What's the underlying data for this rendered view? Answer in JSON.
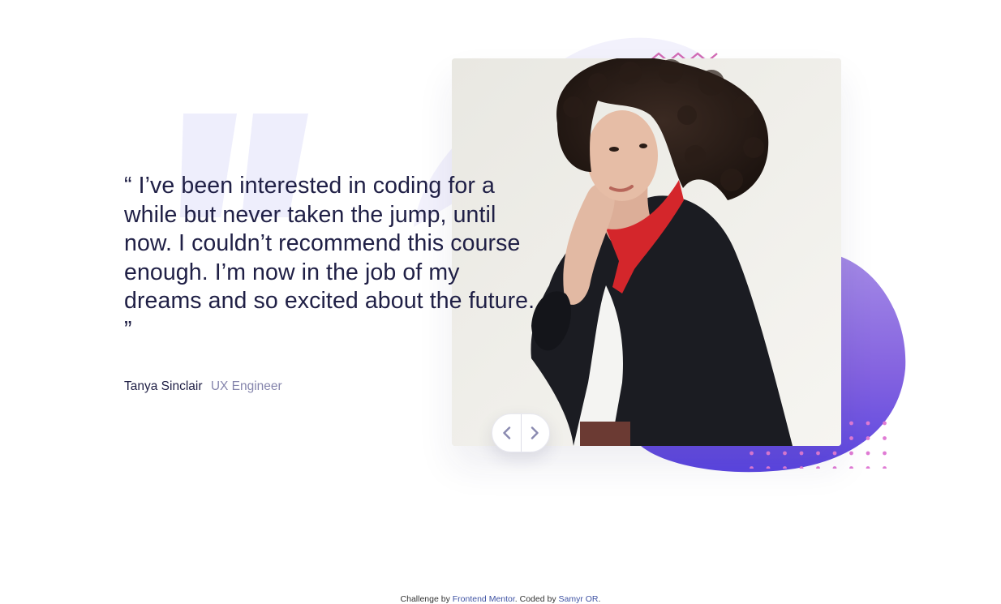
{
  "testimonial": {
    "quote": "“ I’ve been interested in coding for a while but never taken the jump, until now. I couldn’t recommend this course enough. I’m now in the job of my dreams and so excited about the future. ”",
    "author_name": "Tanya Sinclair",
    "author_role": "UX Engineer"
  },
  "controls": {
    "prev_icon": "chevron-left-icon",
    "next_icon": "chevron-right-icon"
  },
  "attribution": {
    "prefix": "Challenge by",
    "challenge_link": "Frontend Mentor",
    "middle": ". Coded by",
    "author_link": "Samyr OR",
    "suffix": "."
  },
  "colors": {
    "text_dark": "#202046",
    "text_muted": "#8585ac",
    "blob_start": "#8a6ee0",
    "blob_end": "#5a45e0",
    "dots": "#e07bd4",
    "quote_mark": "#eeeefc"
  }
}
